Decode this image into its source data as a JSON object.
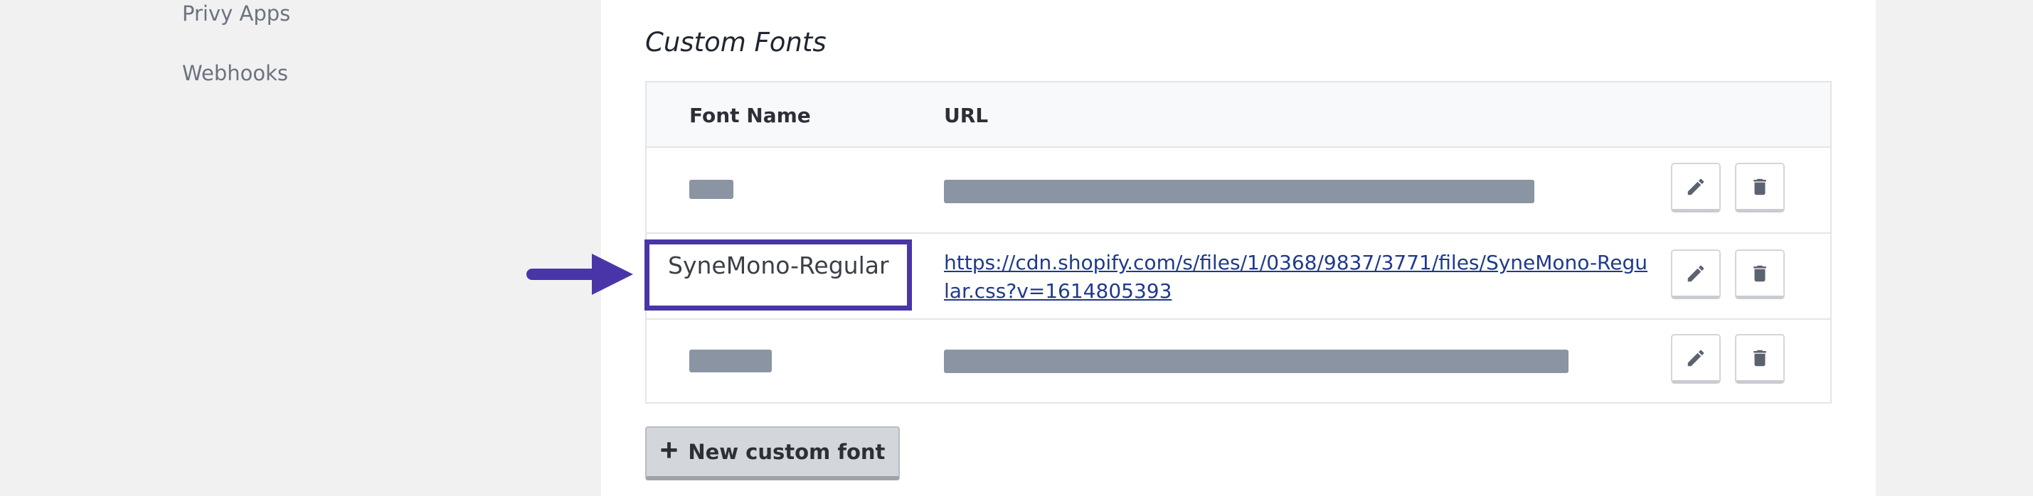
{
  "sidebar": {
    "items": [
      {
        "label": "Privy Apps"
      },
      {
        "label": "Webhooks"
      }
    ]
  },
  "custom_fonts": {
    "title": "Custom Fonts",
    "columns": {
      "font_name": "Font Name",
      "url": "URL"
    },
    "rows": [
      {
        "font_name": "",
        "url": "",
        "redacted": true
      },
      {
        "font_name": "SyneMono-Regular",
        "url": "https://cdn.shopify.com/s/files/1/0368/9837/3771/files/SyneMono-Regular.css?v=1614805393",
        "redacted": false
      },
      {
        "font_name": "",
        "url": "",
        "redacted": true
      }
    ],
    "row_actions": {
      "edit_icon": "pencil-icon",
      "delete_icon": "trash-icon"
    },
    "new_button_label": "New custom font",
    "new_button_icon": "plus-icon"
  },
  "annotation": {
    "color": "#4a35a8",
    "arrow_icon": "arrow-right-icon"
  }
}
